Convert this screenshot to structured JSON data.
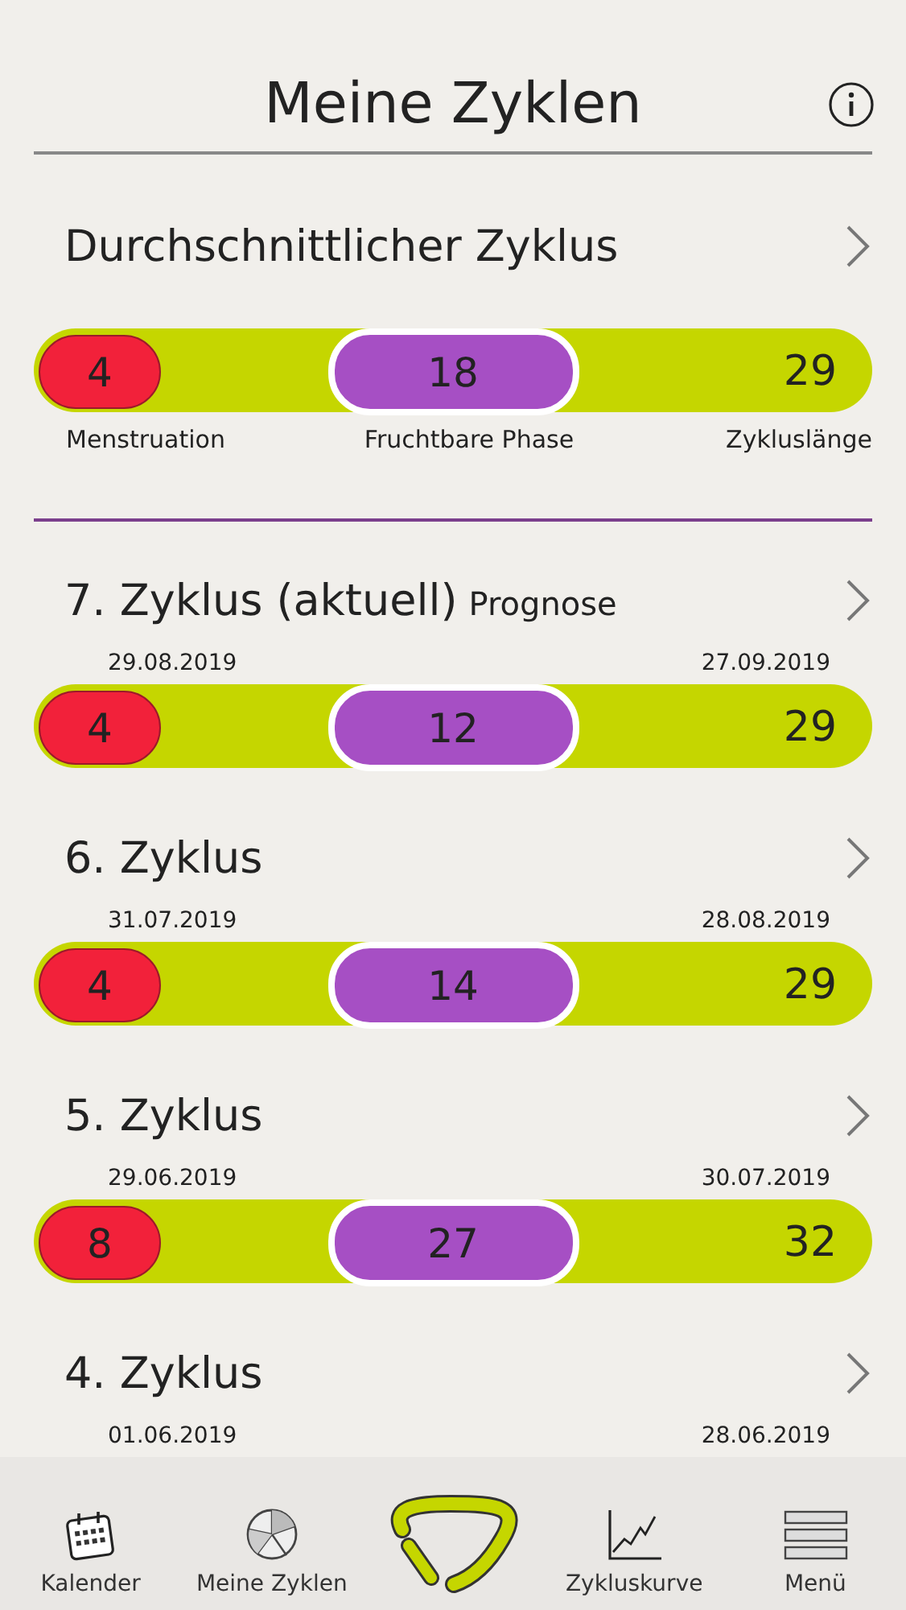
{
  "header": {
    "title": "Meine Zyklen"
  },
  "average": {
    "title": "Durchschnittlicher Zyklus",
    "menstruation": "4",
    "fertile": "18",
    "length": "29",
    "labels": [
      "Menstruation",
      "Fruchtbare Phase",
      "Zykluslänge"
    ]
  },
  "cycles": [
    {
      "title": "7. Zyklus (aktuell)",
      "note": "Prognose",
      "start": "29.08.2019",
      "end": "27.09.2019",
      "menstruation": "4",
      "fertile": "12",
      "length": "29"
    },
    {
      "title": "6. Zyklus",
      "start": "31.07.2019",
      "end": "28.08.2019",
      "menstruation": "4",
      "fertile": "14",
      "length": "29"
    },
    {
      "title": "5. Zyklus",
      "start": "29.06.2019",
      "end": "30.07.2019",
      "menstruation": "8",
      "fertile": "27",
      "length": "32"
    },
    {
      "title": "4. Zyklus",
      "start": "01.06.2019",
      "end": "28.06.2019"
    }
  ],
  "nav": [
    {
      "kind": "calendar",
      "label": "Kalender"
    },
    {
      "kind": "pie",
      "label": "Meine Zyklen"
    },
    {
      "kind": "logo"
    },
    {
      "kind": "curve",
      "label": "Zykluskurve"
    },
    {
      "kind": "menu",
      "label": "Menü"
    }
  ]
}
